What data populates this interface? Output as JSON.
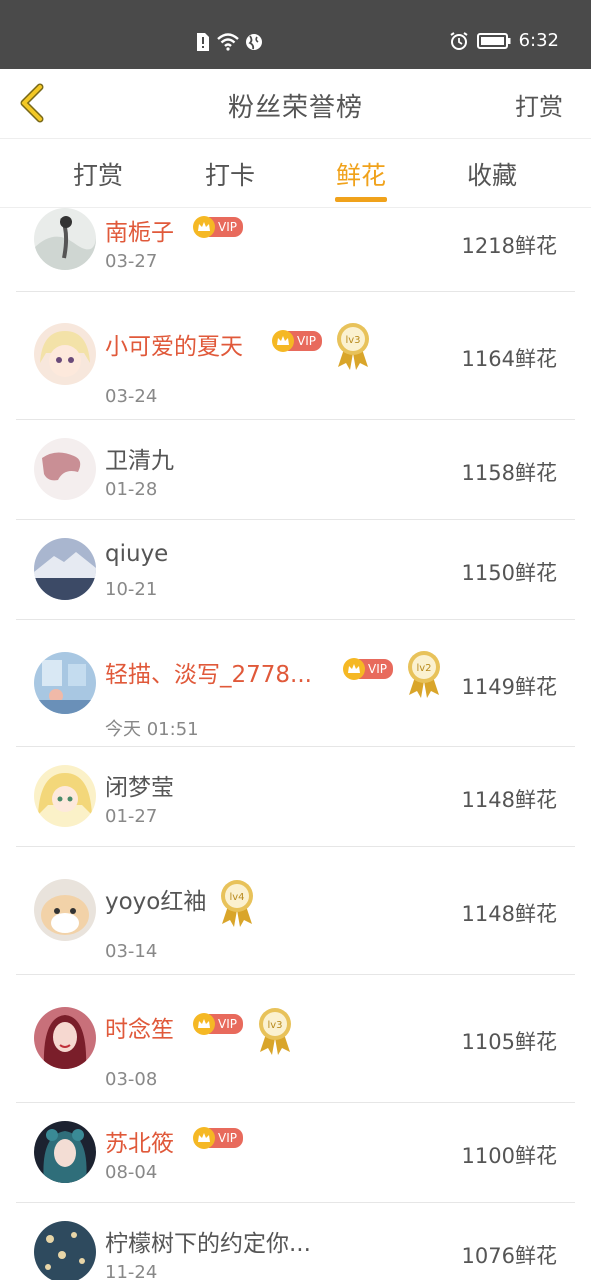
{
  "status_bar": {
    "time": "6:32"
  },
  "header": {
    "title": "粉丝荣誉榜",
    "right_action": "打赏"
  },
  "tabs": [
    {
      "label": "打卡"
    },
    {
      "label": "打赏"
    },
    {
      "label": "鲜花"
    },
    {
      "label": "收藏"
    }
  ],
  "tab_order": [
    "打赏",
    "打卡",
    "鲜花",
    "收藏"
  ],
  "tab_labels": {
    "reward": "打赏",
    "checkin": "打卡",
    "flowers": "鲜花",
    "favorites": "收藏"
  },
  "active_tab": "鲜花",
  "vip_label": "VIP",
  "list": [
    {
      "name": "南栀子",
      "date": "03-27",
      "amount": "1218鲜花",
      "vip": true,
      "level": null
    },
    {
      "name": "小可爱的夏天",
      "date": "03-24",
      "amount": "1164鲜花",
      "vip": true,
      "level": "lv3"
    },
    {
      "name": "卫清九",
      "date": "01-28",
      "amount": "1158鲜花",
      "vip": false,
      "level": null
    },
    {
      "name": "qiuye",
      "date": "10-21",
      "amount": "1150鲜花",
      "vip": false,
      "level": null
    },
    {
      "name": "轻描、淡写_2778...",
      "date": "今天 01:51",
      "amount": "1149鲜花",
      "vip": true,
      "level": "lv2"
    },
    {
      "name": "闭梦莹",
      "date": "01-27",
      "amount": "1148鲜花",
      "vip": false,
      "level": null
    },
    {
      "name": "yoyo红袖",
      "date": "03-14",
      "amount": "1148鲜花",
      "vip": false,
      "level": "lv4"
    },
    {
      "name": "时念笙",
      "date": "03-08",
      "amount": "1105鲜花",
      "vip": true,
      "level": "lv3"
    },
    {
      "name": "苏北筱",
      "date": "08-04",
      "amount": "1100鲜花",
      "vip": true,
      "level": null
    },
    {
      "name": "柠檬树下的约定你...",
      "date": "11-24",
      "amount": "1076鲜花",
      "vip": false,
      "level": null
    }
  ],
  "colors": {
    "accent": "#f0a21b",
    "vip_name": "#e0593a",
    "statusbar": "#4a4a4a"
  }
}
